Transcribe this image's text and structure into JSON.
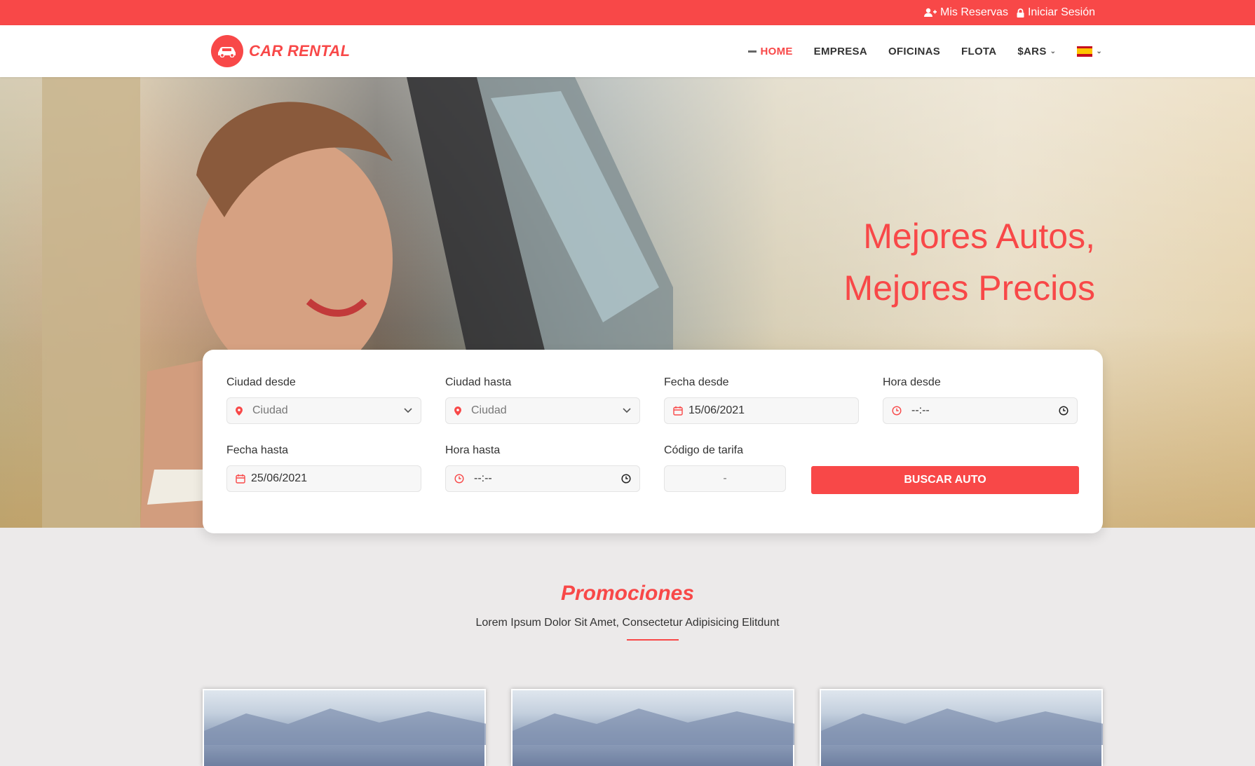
{
  "topbar": {
    "my_bookings": "Mis Reservas",
    "login": "Iniciar Sesión",
    "bg_color": "#f84848"
  },
  "header": {
    "logo_text": "CAR RENTAL",
    "nav": [
      {
        "label": "HOME",
        "active": true
      },
      {
        "label": "EMPRESA"
      },
      {
        "label": "OFICINAS"
      },
      {
        "label": "FLOTA"
      },
      {
        "label": "$ARS"
      }
    ],
    "language": "es"
  },
  "hero": {
    "title_line1": "Mejores Autos,",
    "title_line2": "Mejores Precios"
  },
  "search": {
    "city_from": {
      "label": "Ciudad desde",
      "placeholder": "Ciudad"
    },
    "city_to": {
      "label": "Ciudad hasta",
      "placeholder": "Ciudad"
    },
    "date_from": {
      "label": "Fecha desde",
      "value": "15/06/2021"
    },
    "time_from": {
      "label": "Hora desde",
      "value": "--:--"
    },
    "date_to": {
      "label": "Fecha hasta",
      "value": "25/06/2021"
    },
    "time_to": {
      "label": "Hora hasta",
      "value": "--:--"
    },
    "rate_code": {
      "label": "Código de tarifa",
      "value": "-"
    },
    "button": "BUSCAR AUTO"
  },
  "promotions": {
    "title": "Promociones",
    "subtitle": "Lorem Ipsum Dolor Sit Amet, Consectetur Adipisicing Elitdunt",
    "cards": 3
  },
  "colors": {
    "accent": "#f84848"
  }
}
